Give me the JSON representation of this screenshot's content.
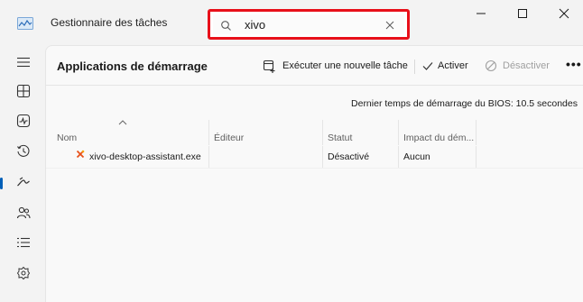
{
  "window": {
    "title": "Gestionnaire des tâches",
    "controls": [
      "minimize",
      "maximize",
      "close"
    ]
  },
  "search": {
    "value": "xivo",
    "highlight_color": "#e8101a"
  },
  "sidebar": {
    "items": [
      {
        "name": "menu-icon",
        "selected": false
      },
      {
        "name": "processes-icon",
        "selected": false
      },
      {
        "name": "performance-icon",
        "selected": false
      },
      {
        "name": "app-history-icon",
        "selected": false
      },
      {
        "name": "startup-apps-icon",
        "selected": true
      },
      {
        "name": "users-icon",
        "selected": false
      },
      {
        "name": "details-icon",
        "selected": false
      },
      {
        "name": "services-icon",
        "selected": false
      }
    ],
    "accent_color": "#005fb8"
  },
  "page": {
    "title": "Applications de démarrage"
  },
  "toolbar": {
    "run_new_task": "Exécuter une nouvelle tâche",
    "enable": "Activer",
    "disable": "Désactiver",
    "more": "•••"
  },
  "bios": {
    "text": "Dernier temps de démarrage du BIOS: 10.5 secondes"
  },
  "table": {
    "columns": [
      "Nom",
      "Éditeur",
      "Statut",
      "Impact du dém..."
    ],
    "rows": [
      {
        "name": "xivo-desktop-assistant.exe",
        "publisher": "",
        "status": "Désactivé",
        "impact": "Aucun"
      }
    ]
  }
}
